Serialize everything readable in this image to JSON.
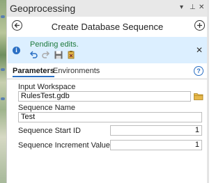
{
  "titlebar": {
    "title": "Geoprocessing",
    "dropdown_glyph": "▾",
    "pin_glyph": "⊥",
    "close_glyph": "✕"
  },
  "tool": {
    "title": "Create Database Sequence"
  },
  "banner": {
    "message": "Pending edits.",
    "close_glyph": "✕",
    "info_glyph": "i"
  },
  "tabs": {
    "parameters": "Parameters",
    "environments": "Environments",
    "help_glyph": "?"
  },
  "params": {
    "input_workspace": {
      "label": "Input Workspace",
      "value": "RulesTest.gdb"
    },
    "sequence_name": {
      "label": "Sequence Name",
      "value": "Test"
    },
    "start_id": {
      "label": "Sequence Start ID",
      "value": "1"
    },
    "increment": {
      "label": "Sequence Increment Value",
      "value": "1"
    }
  },
  "colors": {
    "accent": "#2a6fc4",
    "banner_bg": "#dcefff",
    "pending_text": "#1f7a3c"
  }
}
